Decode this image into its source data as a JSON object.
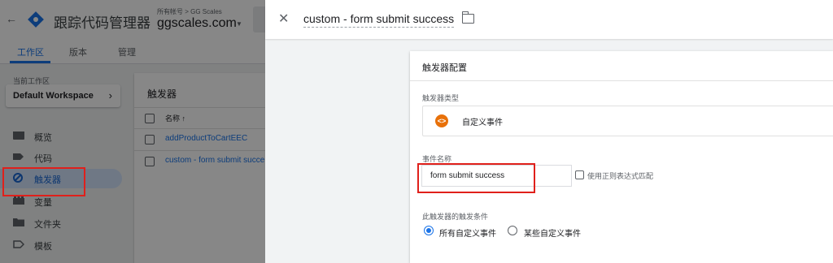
{
  "app": {
    "back_icon": "arrow-back-icon",
    "logo_icon": "gtm-diamond-logo",
    "title": "跟踪代码管理器",
    "account_breadcrumb": "所有帐号 > GG Scales",
    "container": "ggscales.com",
    "container_dropdown_icon": "caret-down-icon"
  },
  "tabs": [
    "工作区",
    "版本",
    "管理"
  ],
  "workspace": {
    "label": "当前工作区",
    "name": "Default Workspace",
    "chevron": "›"
  },
  "nav": [
    {
      "label": "概览",
      "icon": "overview-icon"
    },
    {
      "label": "代码",
      "icon": "tag-icon"
    },
    {
      "label": "触发器",
      "icon": "trigger-icon"
    },
    {
      "label": "变量",
      "icon": "variable-icon"
    },
    {
      "label": "文件夹",
      "icon": "folder-icon"
    },
    {
      "label": "模板",
      "icon": "template-icon"
    }
  ],
  "triggers_card": {
    "title": "触发器",
    "column_name": "名称 ↑",
    "rows": [
      "addProductToCartEEC",
      "custom - form submit succe"
    ]
  },
  "panel": {
    "close_icon": "close-icon",
    "title": "custom - form submit success",
    "folder_icon": "folder-icon",
    "config_title": "触发器配置",
    "type_label": "触发器类型",
    "type_icon": "custom-event-icon",
    "type_icon_glyph": "<>",
    "type_value": "自定义事件",
    "event_label": "事件名称",
    "event_value": "form submit success",
    "regex_label": "使用正则表达式匹配",
    "fires_on_label": "此触发器的触发条件",
    "options": [
      "所有自定义事件",
      "某些自定义事件"
    ],
    "selected_option": "所有自定义事件"
  },
  "colors": {
    "accent": "#1a73e8",
    "highlight_box": "#e0201b",
    "custom_event_icon": "#e8710a"
  }
}
